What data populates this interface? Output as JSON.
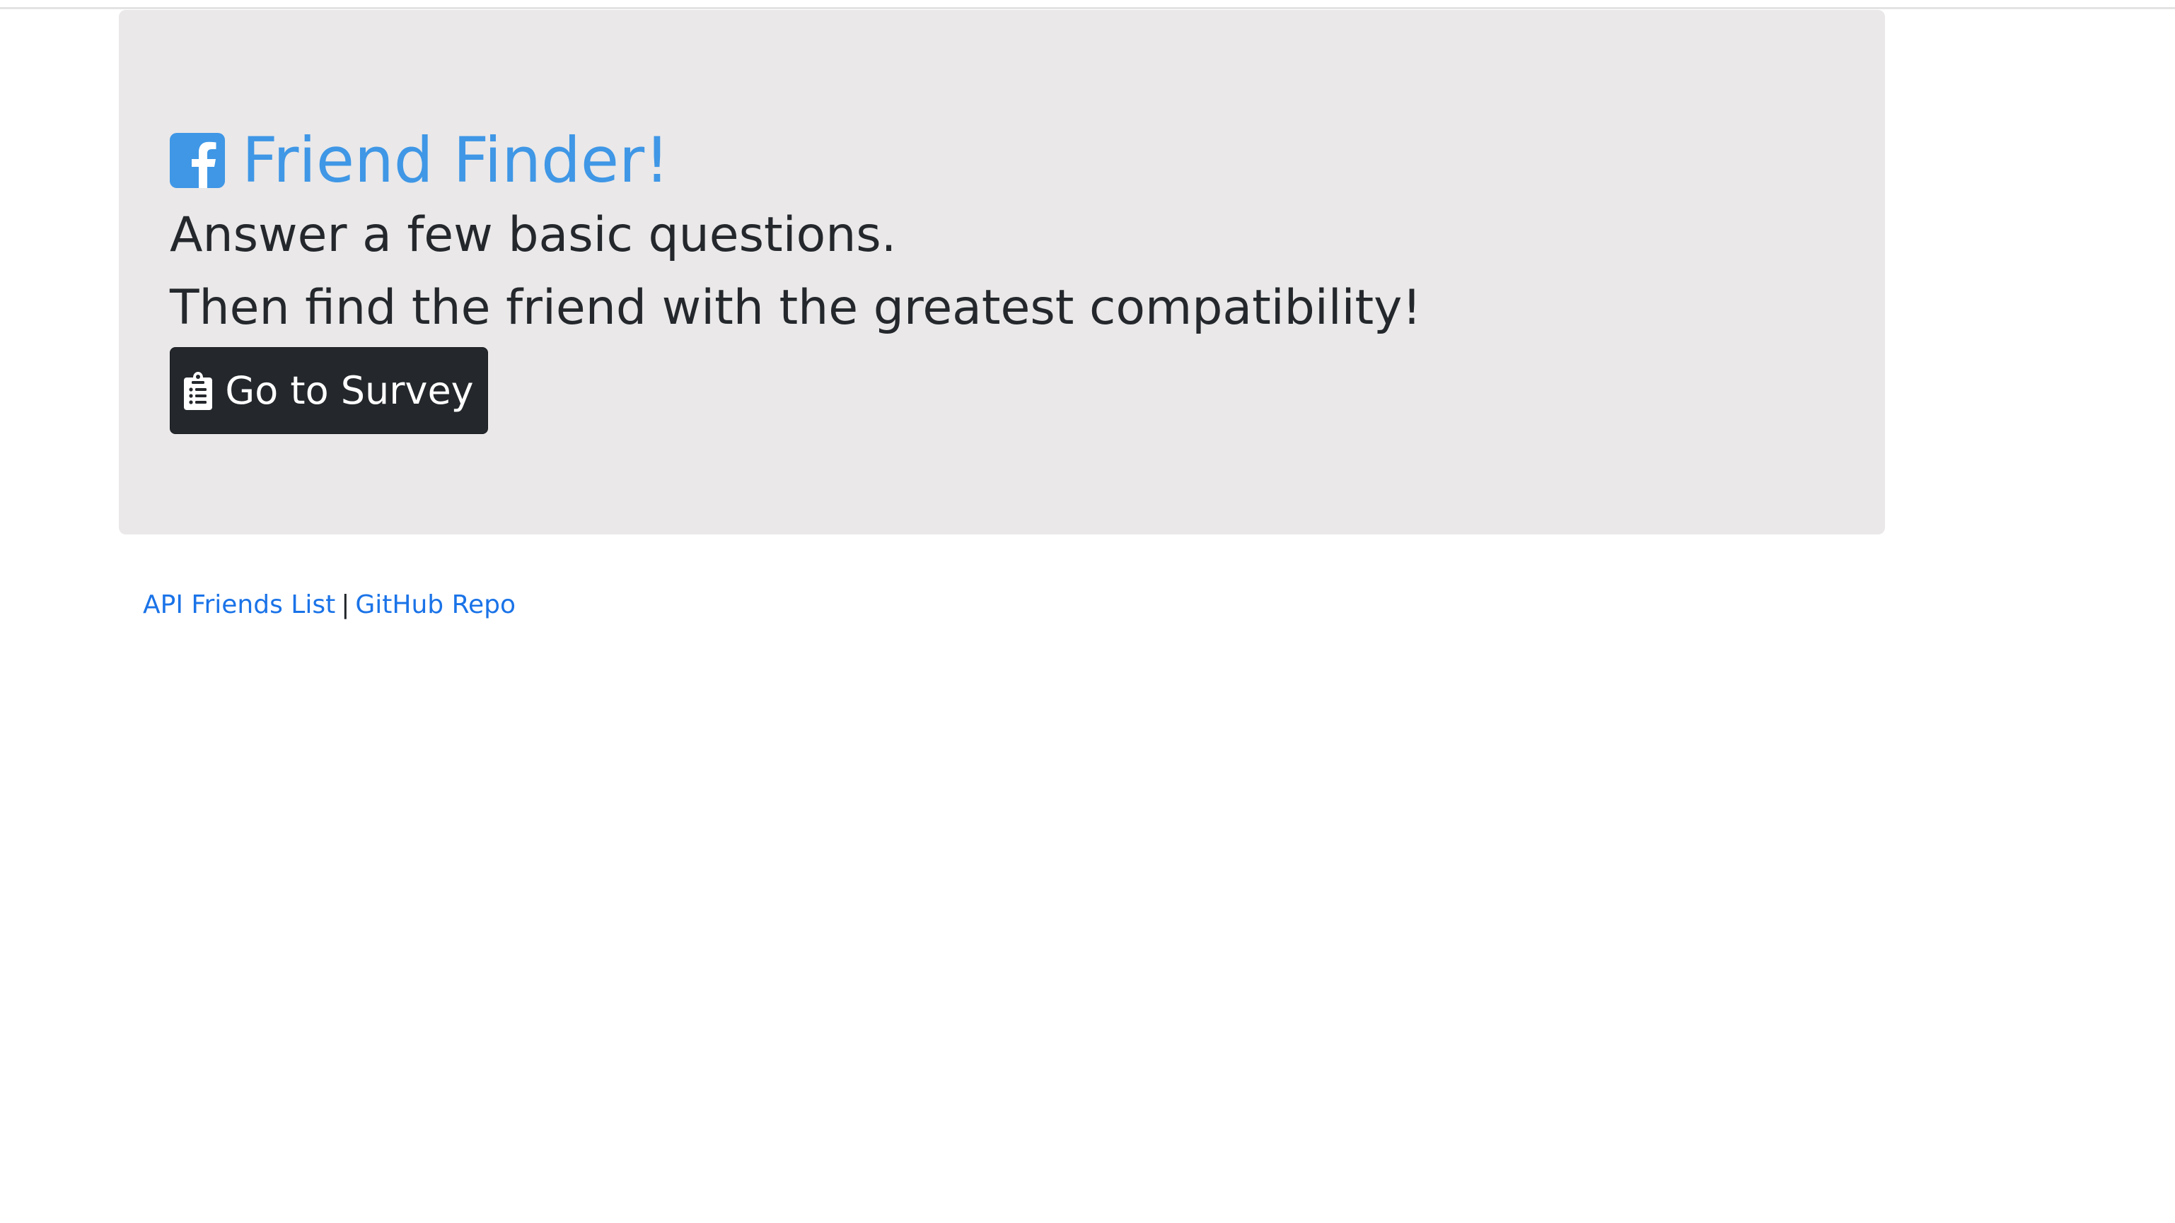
{
  "header": {
    "title": "Friend Finder!",
    "icon": "facebook-square-icon",
    "title_color": "#3f97e6"
  },
  "jumbotron": {
    "background": "#eae8e9",
    "lead_line_1": "Answer a few basic questions.",
    "lead_line_2": "Then find the friend with the greatest compatibility!"
  },
  "survey_button": {
    "label": "Go to Survey",
    "icon": "clipboard-list-icon",
    "background": "#24282c"
  },
  "footer": {
    "api_link_label": "API Friends List",
    "separator": "|",
    "github_link_label": "GitHub Repo",
    "link_color": "#1a73e8"
  }
}
